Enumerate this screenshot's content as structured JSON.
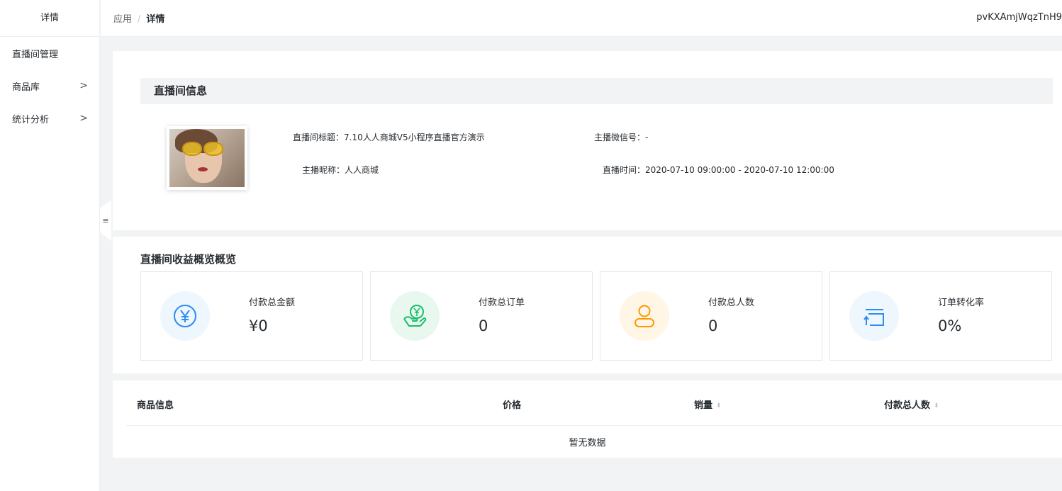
{
  "sidebar": {
    "title": "详情",
    "items": [
      {
        "label": "直播间管理",
        "chevron": ""
      },
      {
        "label": "商品库",
        "chevron": ">"
      },
      {
        "label": "统计分析",
        "chevron": ">"
      }
    ]
  },
  "header": {
    "breadcrumb": [
      "应用",
      "详情"
    ],
    "separator": "/",
    "user_id": "pvKXAmjWqzTnH9"
  },
  "collapse_icon": "≡",
  "room_info": {
    "section_title": "直播间信息",
    "title_label": "直播间标题：",
    "title_value": "7.10人人商城V5小程序直播官方演示",
    "anchor_wechat_label": "主播微信号：",
    "anchor_wechat_value": "-",
    "anchor_nickname_label": "主播昵称：",
    "anchor_nickname_value": "人人商城",
    "live_time_label": "直播时间：",
    "live_time_value": "2020-07-10 09:00:00 - 2020-07-10 12:00:00"
  },
  "overview": {
    "title": "直播间收益概览概览",
    "stats": [
      {
        "label": "付款总金额",
        "value": "¥0",
        "icon": "yen-circle-icon",
        "color": "#2d8cf0",
        "bg": "#eef6fe"
      },
      {
        "label": "付款总订单",
        "value": "0",
        "icon": "money-hand-icon",
        "color": "#19be6b",
        "bg": "#e8f8ef"
      },
      {
        "label": "付款总人数",
        "value": "0",
        "icon": "user-icon",
        "color": "#ff9900",
        "bg": "#fff6e6"
      },
      {
        "label": "订单转化率",
        "value": "0%",
        "icon": "conversion-icon",
        "color": "#2d8cf0",
        "bg": "#eef6fe"
      }
    ]
  },
  "table": {
    "columns": [
      "商品信息",
      "价格",
      "销量",
      "付款总人数"
    ],
    "sort_icon": "⬍",
    "empty_text": "暂无数据"
  }
}
